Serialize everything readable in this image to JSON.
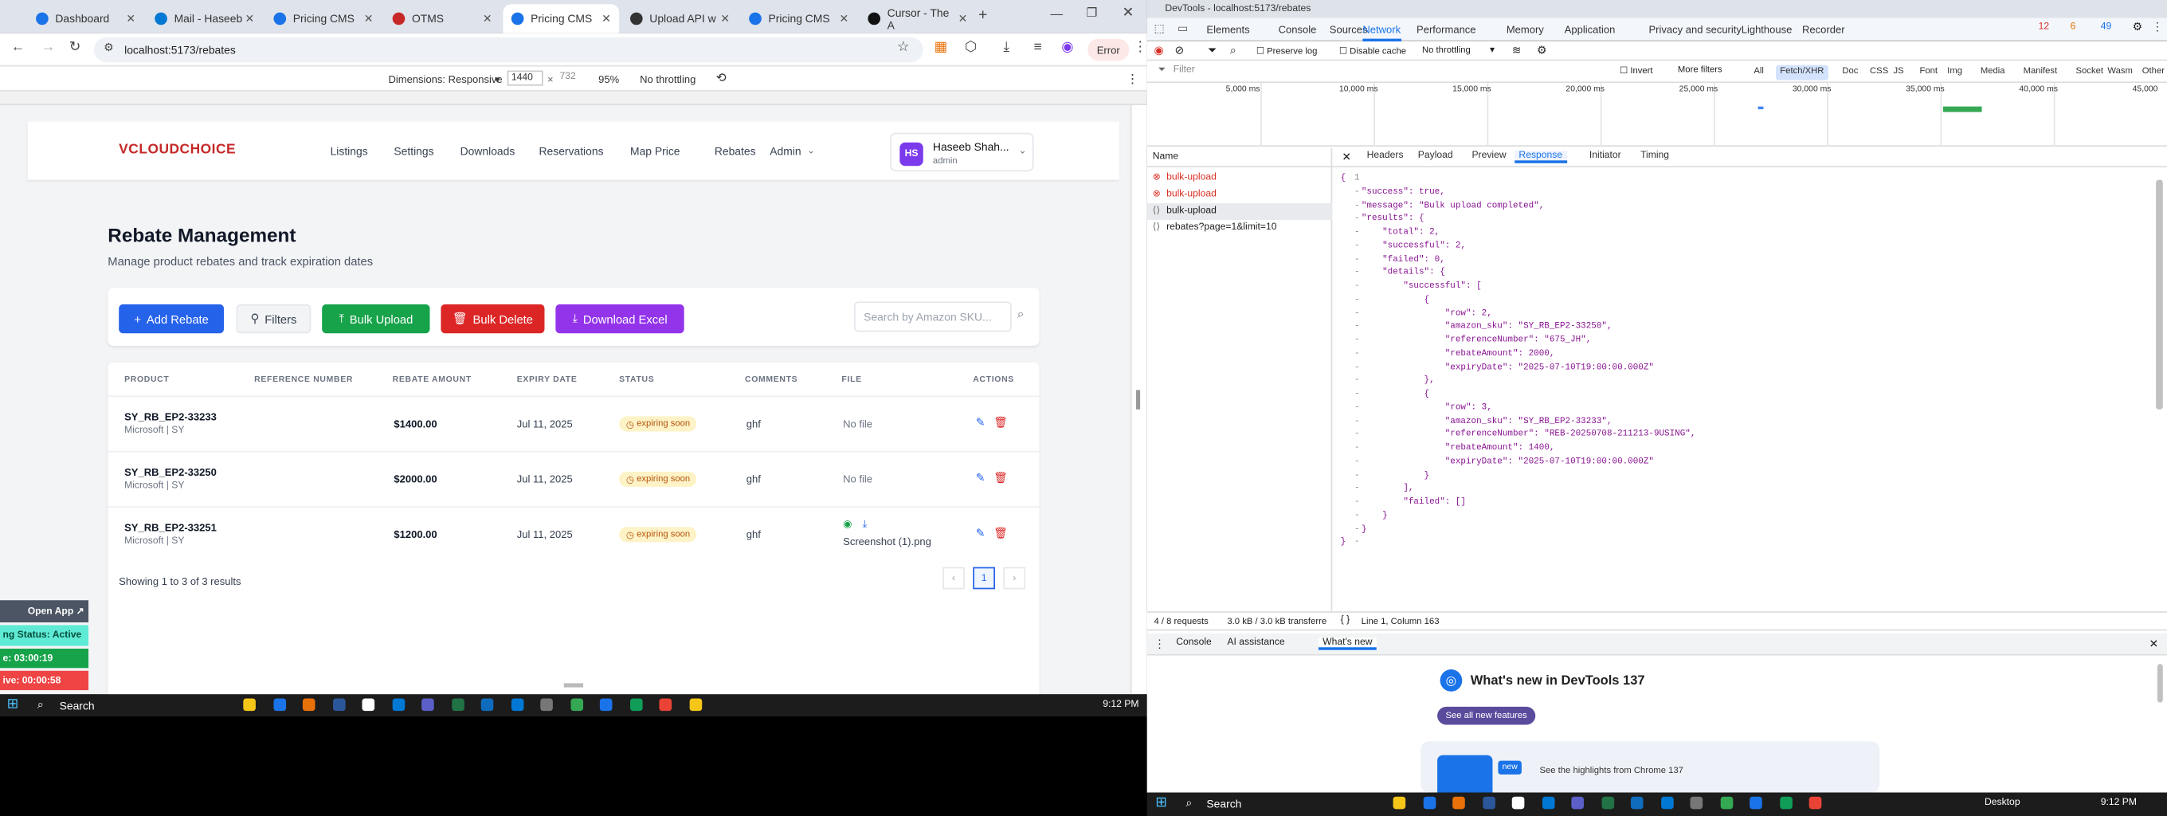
{
  "browser": {
    "tabs": [
      {
        "label": "Dashboard",
        "color": "#1a73e8"
      },
      {
        "label": "Mail - Haseeb",
        "color": "#0078d4"
      },
      {
        "label": "Pricing CMS",
        "color": "#1a73e8"
      },
      {
        "label": "OTMS",
        "color": "#c62828"
      },
      {
        "label": "Pricing CMS",
        "color": "#1a73e8"
      },
      {
        "label": "Upload API w",
        "color": "#333333"
      },
      {
        "label": "Pricing CMS",
        "color": "#1a73e8"
      },
      {
        "label": "Cursor - The A",
        "color": "#111111"
      }
    ],
    "url": "localhost:5173/rebates",
    "error_label": "Error",
    "device": {
      "dimensions": "Dimensions: Responsive",
      "width": "1440",
      "height": "732",
      "zoom": "95%",
      "throttle": "No throttling"
    }
  },
  "app": {
    "logo": "VCLOUDCHOICE",
    "nav": [
      "Listings",
      "Settings",
      "Downloads",
      "Reservations",
      "Map Price",
      "Rebates",
      "Admin"
    ],
    "user": {
      "initials": "HS",
      "name": "Haseeb Shah...",
      "role": "admin"
    },
    "title": "Rebate Management",
    "subtitle": "Manage product rebates and track expiration dates",
    "buttons": {
      "add": "Add Rebate",
      "filters": "Filters",
      "bulk_upload": "Bulk Upload",
      "bulk_delete": "Bulk Delete",
      "download": "Download Excel"
    },
    "search_placeholder": "Search by Amazon SKU...",
    "columns": [
      "PRODUCT",
      "REFERENCE NUMBER",
      "REBATE AMOUNT",
      "EXPIRY DATE",
      "STATUS",
      "COMMENTS",
      "FILE",
      "ACTIONS"
    ],
    "rows": [
      {
        "sku": "SY_RB_EP2-33233",
        "brand": "Microsoft | SY",
        "ref": "",
        "amount": "$1400.00",
        "expiry": "Jul 11, 2025",
        "status": "expiring soon",
        "comment": "ghf",
        "file": "No file"
      },
      {
        "sku": "SY_RB_EP2-33250",
        "brand": "Microsoft | SY",
        "ref": "",
        "amount": "$2000.00",
        "expiry": "Jul 11, 2025",
        "status": "expiring soon",
        "comment": "ghf",
        "file": "No file"
      },
      {
        "sku": "SY_RB_EP2-33251",
        "brand": "Microsoft | SY",
        "ref": "",
        "amount": "$1200.00",
        "expiry": "Jul 11, 2025",
        "status": "expiring soon",
        "comment": "ghf",
        "file": "Screenshot (1).png"
      }
    ],
    "pagination": {
      "summary": "Showing 1 to 3 of 3 results",
      "page": "1"
    }
  },
  "overlay": {
    "open_app": "Open App ↗",
    "status": "ng Status: Active",
    "timer1": "e: 03:00:19",
    "timer2": "ive: 00:00:58"
  },
  "taskbar": {
    "search": "Search",
    "time": "9:12 PM",
    "desktop": "Desktop"
  },
  "devtools": {
    "title": "DevTools - localhost:5173/rebates",
    "tabs": [
      "Elements",
      "Console",
      "Sources",
      "Network",
      "Performance",
      "Memory",
      "Application",
      "Privacy and security",
      "Lighthouse",
      "Recorder"
    ],
    "counts": {
      "errors": "12",
      "warnings": "6",
      "info": "49"
    },
    "preserve_log": "Preserve log",
    "disable_cache": "Disable cache",
    "throttle": "No throttling",
    "filter_placeholder": "Filter",
    "invert": "Invert",
    "more_filters": "More filters",
    "type_filters": [
      "All",
      "Fetch/XHR",
      "Doc",
      "CSS",
      "JS",
      "Font",
      "Img",
      "Media",
      "Manifest",
      "Socket",
      "Wasm",
      "Other"
    ],
    "timeline": [
      "5,000 ms",
      "10,000 ms",
      "15,000 ms",
      "20,000 ms",
      "25,000 ms",
      "30,000 ms",
      "35,000 ms",
      "40,000 ms",
      "45,000"
    ],
    "name_header": "Name",
    "requests": [
      "bulk-upload",
      "bulk-upload",
      "bulk-upload",
      "rebates?page=1&limit=10"
    ],
    "detail_tabs": [
      "Headers",
      "Payload",
      "Preview",
      "Response",
      "Initiator",
      "Timing"
    ],
    "status_bar": {
      "requests": "4 / 8 requests",
      "transferred": "3.0 kB / 3.0 kB transferre",
      "position": "Line 1, Column 163"
    },
    "drawer_tabs": [
      "Console",
      "AI assistance",
      "What's new"
    ],
    "whats_new_title": "What's new in DevTools 137",
    "see_all": "See all new features",
    "highlight": "See the highlights from Chrome 137",
    "new_badge": "new",
    "response_lines": [
      "{",
      "    \"success\": true,",
      "    \"message\": \"Bulk upload completed\",",
      "    \"results\": {",
      "        \"total\": 2,",
      "        \"successful\": 2,",
      "        \"failed\": 0,",
      "        \"details\": {",
      "            \"successful\": [",
      "                {",
      "                    \"row\": 2,",
      "                    \"amazon_sku\": \"SY_RB_EP2-33250\",",
      "                    \"referenceNumber\": \"675_JH\",",
      "                    \"rebateAmount\": 2000,",
      "                    \"expiryDate\": \"2025-07-10T19:00:00.000Z\"",
      "                },",
      "                {",
      "                    \"row\": 3,",
      "                    \"amazon_sku\": \"SY_RB_EP2-33233\",",
      "                    \"referenceNumber\": \"REB-20250708-211213-9USING\",",
      "                    \"rebateAmount\": 1400,",
      "                    \"expiryDate\": \"2025-07-10T19:00:00.000Z\"",
      "                }",
      "            ],",
      "            \"failed\": []",
      "        }",
      "    }",
      "}"
    ]
  }
}
